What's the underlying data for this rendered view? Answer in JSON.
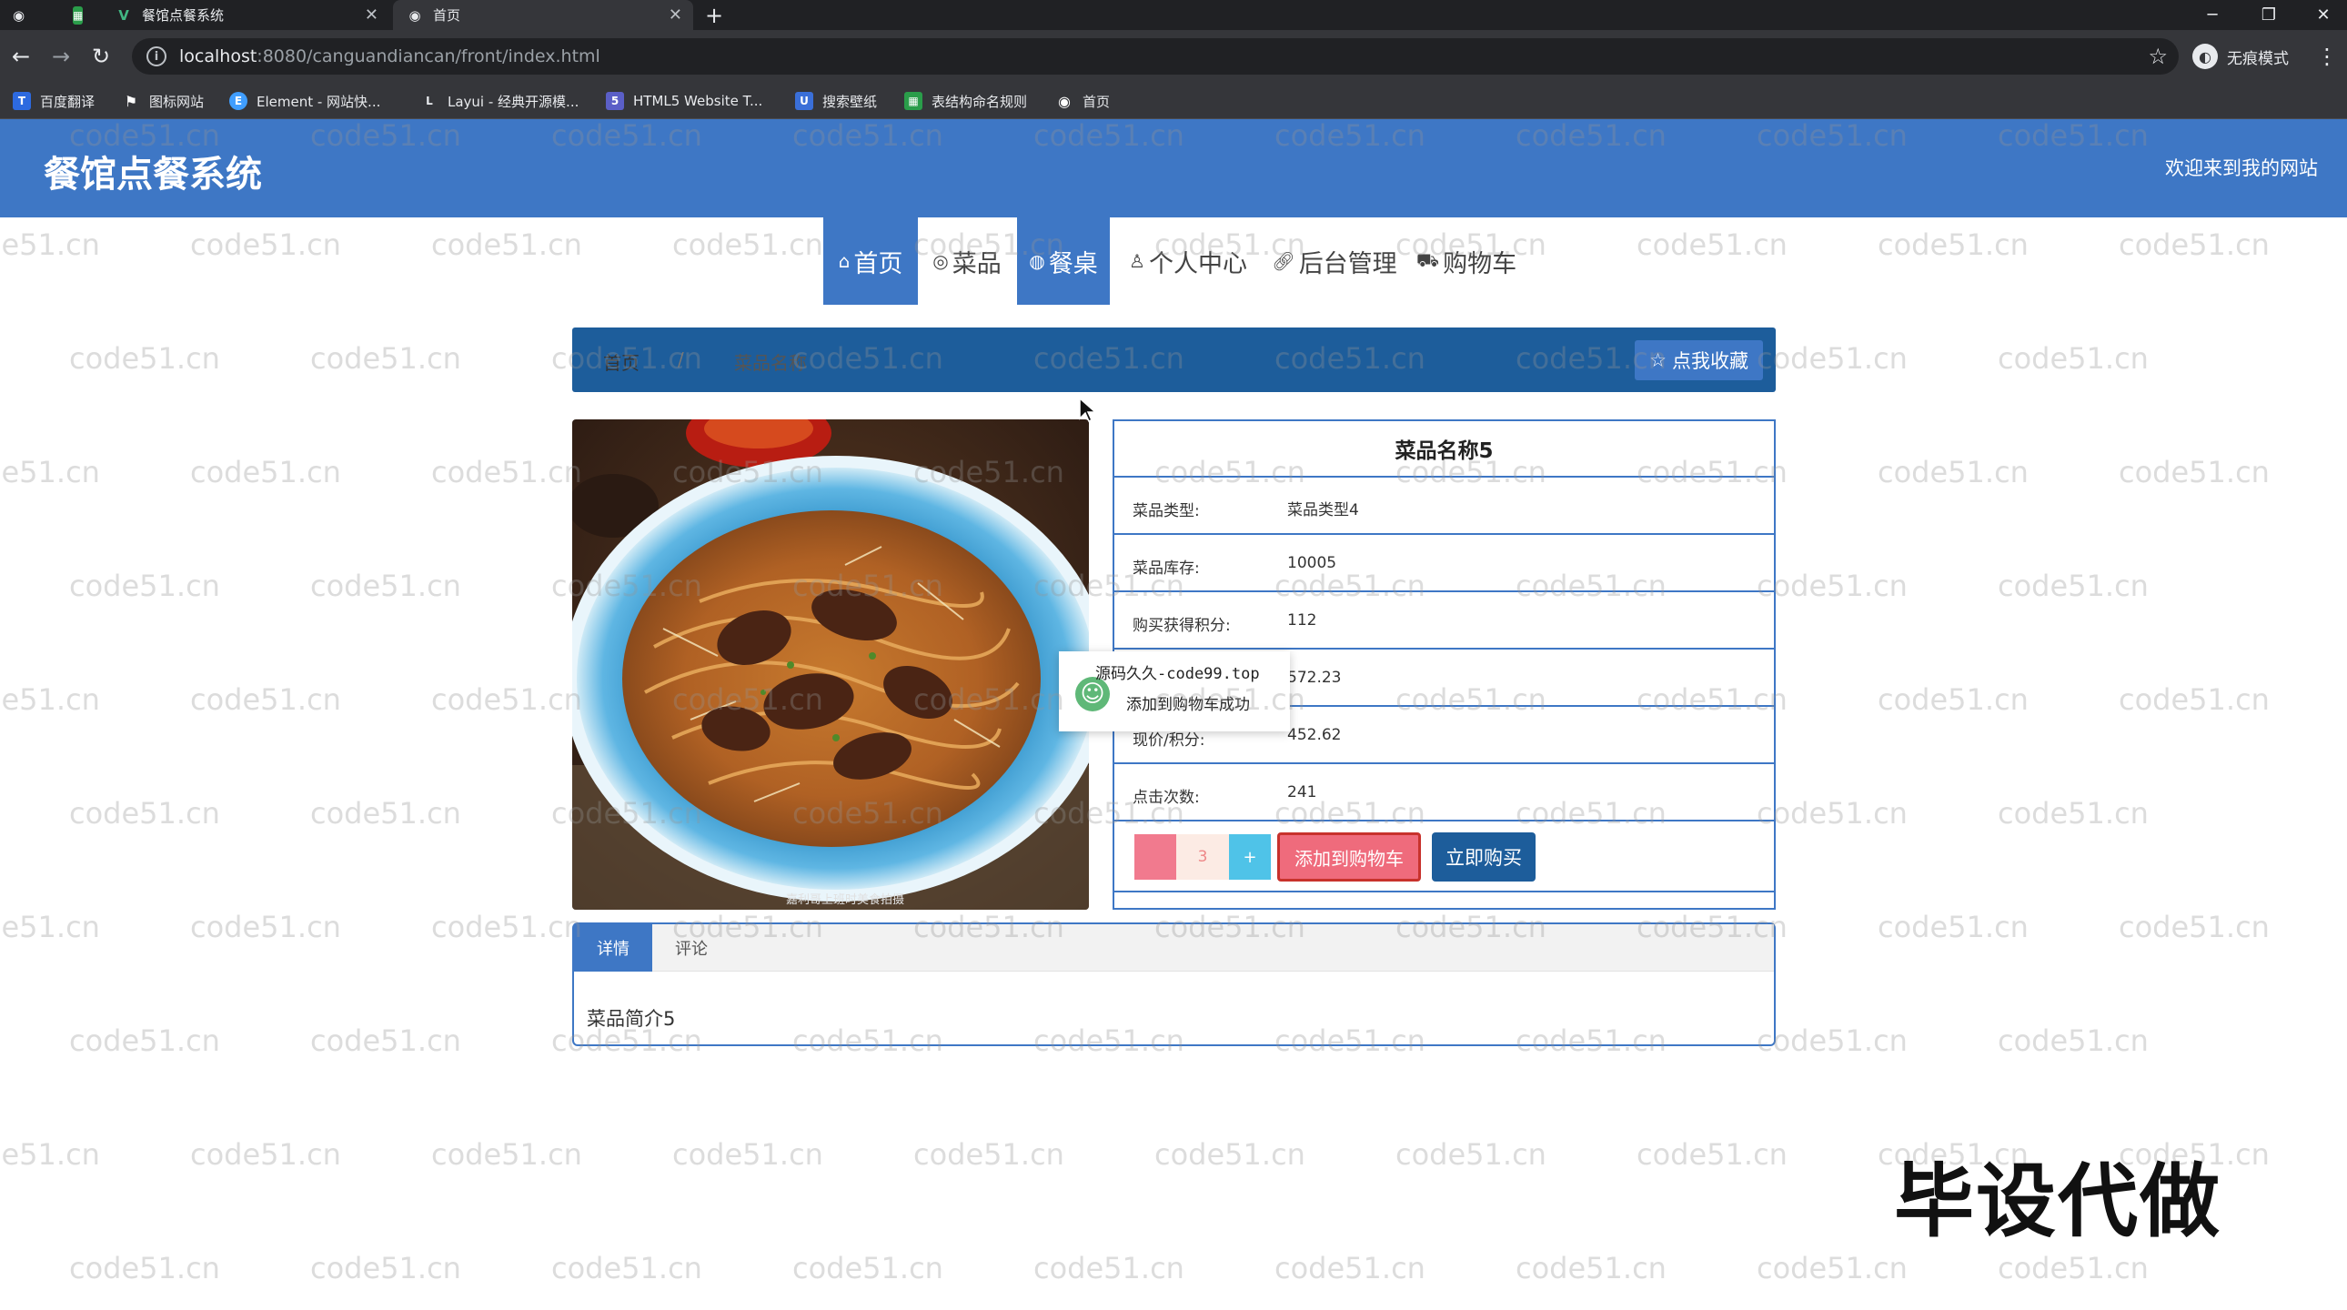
{
  "browser": {
    "tabs": [
      {
        "title": "餐馆点餐系统",
        "active": false
      },
      {
        "title": "首页",
        "active": true
      }
    ],
    "address": {
      "host": "localhost",
      "rest": ":8080/canguandiancan/front/index.html"
    },
    "profile_label": "无痕模式",
    "bookmarks": [
      "百度翻译",
      "图标网站",
      "Element - 网站快...",
      "Layui - 经典开源模...",
      "HTML5 Website T...",
      "搜索壁纸",
      "表结构命名规则",
      "首页"
    ]
  },
  "site": {
    "title": "餐馆点餐系统",
    "welcome": "欢迎来到我的网站"
  },
  "nav": {
    "items": [
      {
        "label": "首页",
        "icon": "home-icon",
        "active": true
      },
      {
        "label": "菜品",
        "icon": "dish-icon",
        "active": false
      },
      {
        "label": "餐桌",
        "icon": "table-icon",
        "active": true
      },
      {
        "label": "个人中心",
        "icon": "user-icon",
        "active": false
      },
      {
        "label": "后台管理",
        "icon": "link-icon",
        "active": false
      },
      {
        "label": "购物车",
        "icon": "cart-icon",
        "active": false
      }
    ]
  },
  "breadcrumb": {
    "home": "首页",
    "separator": "/",
    "current": "菜品名称"
  },
  "favorite_button": "点我收藏",
  "dish": {
    "name": "菜品名称5",
    "fields": [
      {
        "label": "菜品类型:",
        "value": "菜品类型4"
      },
      {
        "label": "菜品库存:",
        "value": "10005"
      },
      {
        "label": "购买获得积分:",
        "value": "112"
      },
      {
        "label": "",
        "value": "572.23"
      },
      {
        "label": "现价/积分:",
        "value": "452.62"
      },
      {
        "label": "点击次数:",
        "value": "241"
      }
    ],
    "quantity": "3",
    "plus": "+",
    "add_to_cart": "添加到购物车",
    "buy_now": "立即购买",
    "photo_caption": "嘉利哥上班时美食拍摄"
  },
  "toast": {
    "line1": "源码久久-code99.top",
    "line2": "添加到购物车成功"
  },
  "detail_tabs": [
    {
      "label": "详情",
      "active": true
    },
    {
      "label": "评论",
      "active": false
    }
  ],
  "detail_text": "菜品简介5",
  "watermark": "code51.cn",
  "overlay_mark": "毕设代做",
  "colors": {
    "primary": "#3e77c5",
    "dark_primary": "#1d5d9b",
    "danger": "#ef6b7c",
    "info": "#4fc3e8"
  }
}
